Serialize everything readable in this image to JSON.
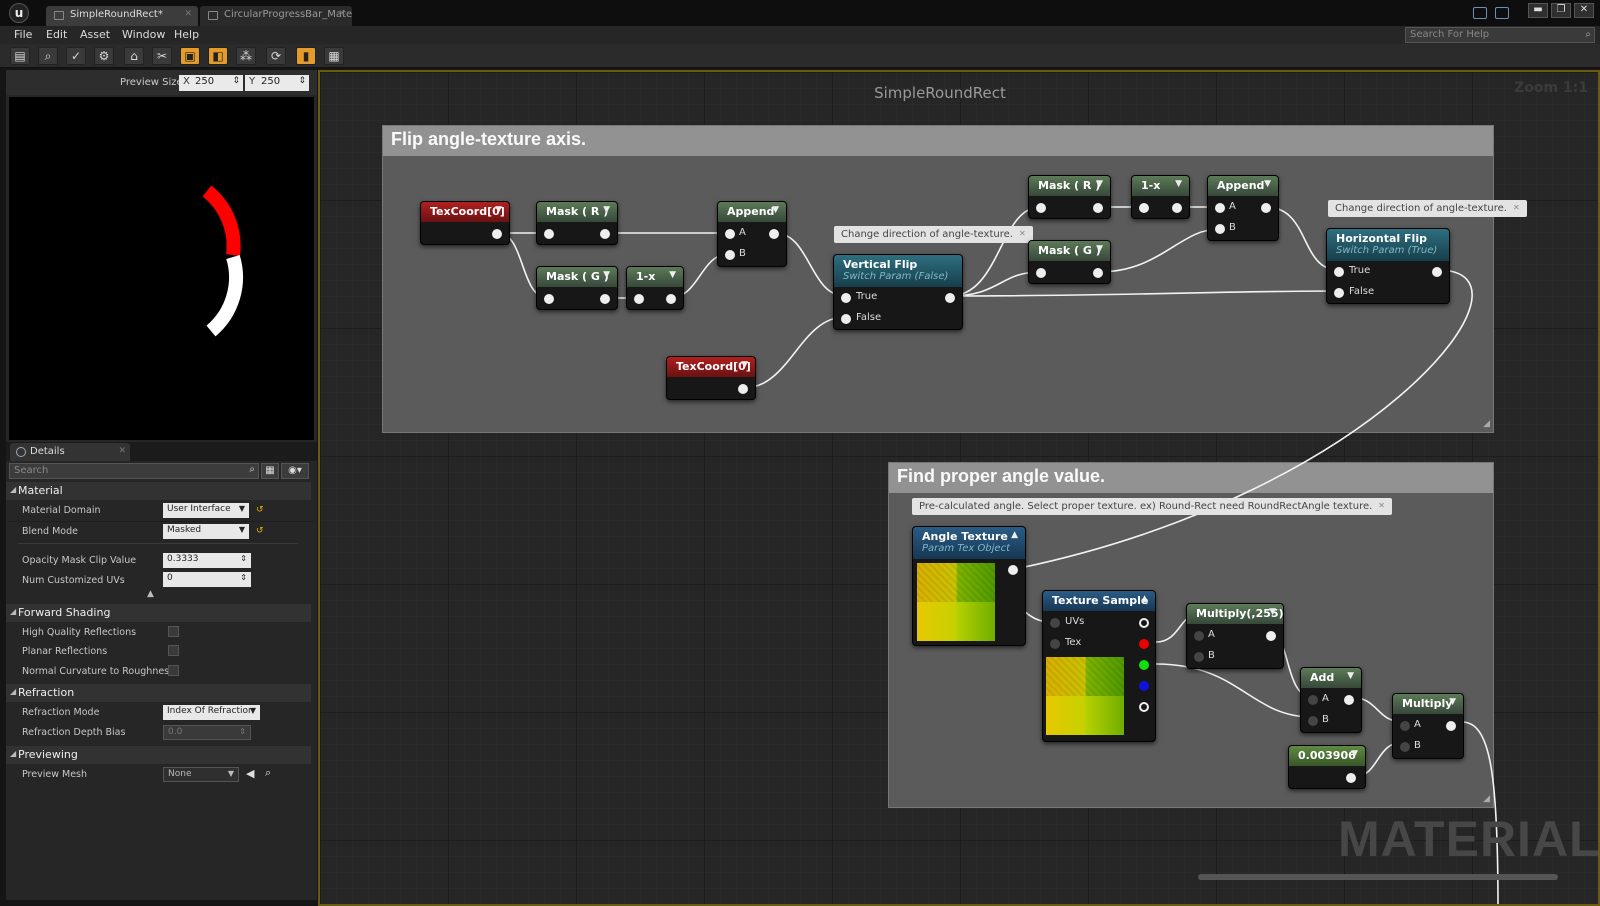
{
  "window": {
    "tabs": [
      {
        "label": "SimpleRoundRect*"
      },
      {
        "label": "CircularProgressBar_Mate"
      }
    ],
    "controls": {
      "minimize": "▬",
      "restore": "❐",
      "close": "✕"
    }
  },
  "menu": {
    "items": [
      "File",
      "Edit",
      "Asset",
      "Window",
      "Help"
    ]
  },
  "help_search": {
    "placeholder": "Search For Help"
  },
  "toolbar": {
    "buttons": [
      {
        "icon": "save-icon",
        "glyph": "▤"
      },
      {
        "icon": "find-icon",
        "glyph": "⌕"
      },
      {
        "icon": "apply-icon",
        "glyph": "✓"
      },
      {
        "icon": "stats-icon",
        "glyph": "⚙"
      },
      {
        "icon": "home-icon",
        "glyph": "⌂"
      },
      {
        "icon": "clean-icon",
        "glyph": "✂"
      },
      {
        "icon": "connectors-icon",
        "glyph": "▣"
      },
      {
        "icon": "live-preview-icon",
        "glyph": "◧"
      },
      {
        "icon": "live-nodes-icon",
        "glyph": "⁂"
      },
      {
        "icon": "live-update-icon",
        "glyph": "⟳"
      },
      {
        "icon": "stats-toggle-icon",
        "glyph": "▮"
      },
      {
        "icon": "release-stats-icon",
        "glyph": "▦"
      }
    ]
  },
  "preview": {
    "size_label": "Preview Size",
    "x_label": "X",
    "x_value": "250",
    "y_label": "Y",
    "y_value": "250"
  },
  "details": {
    "tab_label": "Details",
    "search_placeholder": "Search",
    "sections": {
      "material": {
        "title": "Material",
        "material_domain": {
          "label": "Material Domain",
          "value": "User Interface"
        },
        "blend_mode": {
          "label": "Blend Mode",
          "value": "Masked"
        },
        "opacity_mask_clip": {
          "label": "Opacity Mask Clip Value",
          "value": "0.3333"
        },
        "num_customized_uvs": {
          "label": "Num Customized UVs",
          "value": "0"
        }
      },
      "forward_shading": {
        "title": "Forward Shading",
        "rows": [
          "High Quality Reflections",
          "Planar Reflections",
          "Normal Curvature to Roughness"
        ]
      },
      "refraction": {
        "title": "Refraction",
        "mode": {
          "label": "Refraction Mode",
          "value": "Index Of Refraction"
        },
        "depth_bias": {
          "label": "Refraction Depth Bias",
          "value": "0.0"
        }
      },
      "previewing": {
        "title": "Previewing",
        "preview_mesh": {
          "label": "Preview Mesh",
          "value": "None"
        }
      }
    }
  },
  "graph": {
    "title": "SimpleRoundRect",
    "zoom": "Zoom 1:1",
    "watermark": "MATERIAL",
    "comments": {
      "flip": "Flip angle-texture axis.",
      "find": "Find proper angle value."
    },
    "bubbles": {
      "vflip": "Change direction of angle-texture.",
      "hflip": "Change direction of angle-texture.",
      "angle": "Pre-calculated angle. Select proper texture. ex) Round-Rect need RoundRectAngle texture."
    },
    "nodes": {
      "texcoord1": {
        "title": "TexCoord[0]"
      },
      "texcoord2": {
        "title": "TexCoord[0]"
      },
      "mask_r1": {
        "title": "Mask ( R )"
      },
      "mask_g1": {
        "title": "Mask ( G )"
      },
      "oneminus1": {
        "title": "1-x"
      },
      "append1": {
        "title": "Append",
        "pins": [
          "A",
          "B"
        ]
      },
      "vflip": {
        "title": "Vertical Flip",
        "subtitle": "Switch Param (False)",
        "pins": [
          "True",
          "False"
        ]
      },
      "mask_r2": {
        "title": "Mask ( R )"
      },
      "mask_g2": {
        "title": "Mask ( G )"
      },
      "oneminus2": {
        "title": "1-x"
      },
      "append2": {
        "title": "Append",
        "pins": [
          "A",
          "B"
        ]
      },
      "hflip": {
        "title": "Horizontal Flip",
        "subtitle": "Switch Param (True)",
        "pins": [
          "True",
          "False"
        ]
      },
      "angle_tex": {
        "title": "Angle Texture",
        "subtitle": "Param Tex Object"
      },
      "tex_sample": {
        "title": "Texture Sample",
        "pins": [
          "UVs",
          "Tex"
        ]
      },
      "multiply255": {
        "title": "Multiply(,255)",
        "pins": [
          "A",
          "B"
        ]
      },
      "add": {
        "title": "Add",
        "pins": [
          "A",
          "B"
        ]
      },
      "const": {
        "title": "0.003906"
      },
      "multiply": {
        "title": "Multiply",
        "pins": [
          "A",
          "B"
        ]
      }
    }
  },
  "colors": {
    "accent": "#e39c2a",
    "comment_header": "#929292",
    "red_pin": "#ee0000",
    "green_pin": "#11dd11",
    "blue_pin": "#1111dd"
  }
}
